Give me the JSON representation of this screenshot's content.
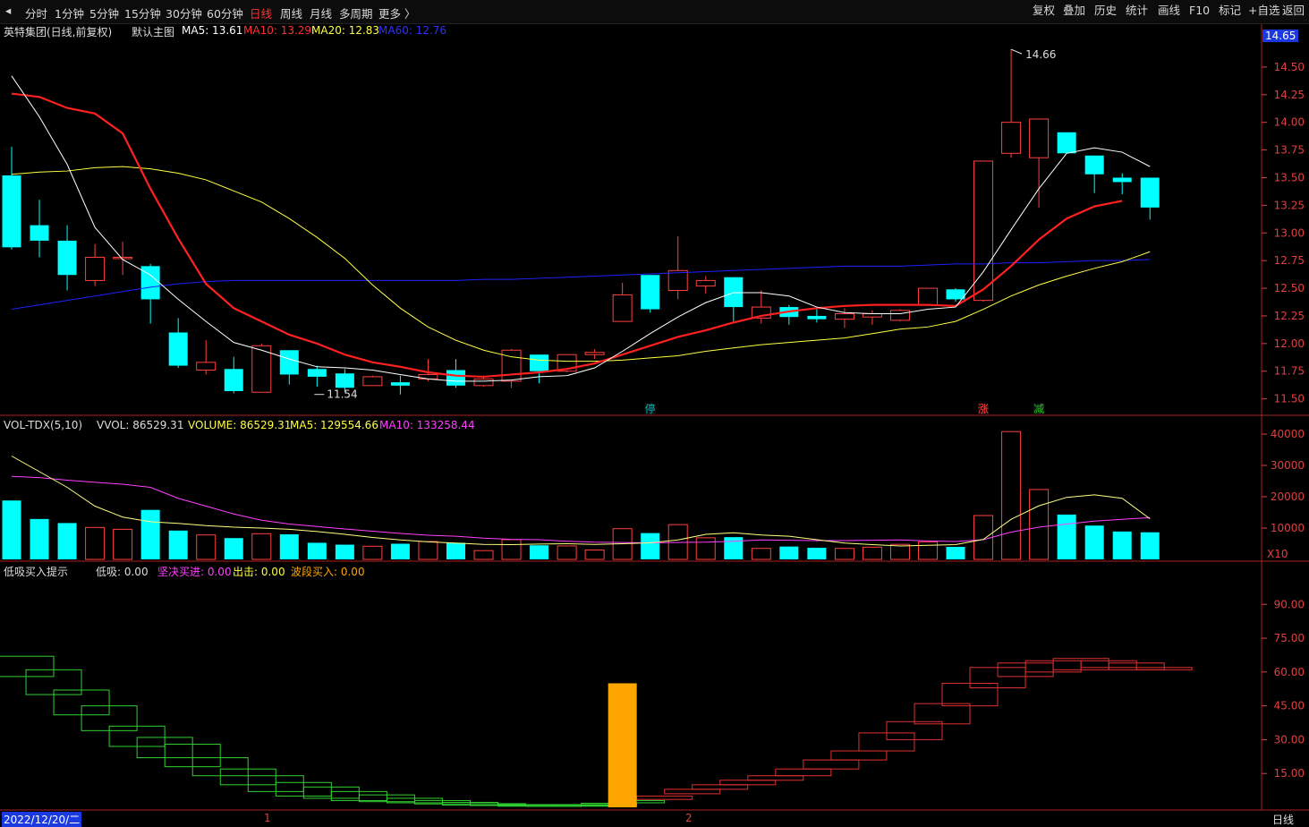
{
  "toolbar": {
    "periods": [
      "分时",
      "1分钟",
      "5分钟",
      "15分钟",
      "30分钟",
      "60分钟",
      "日线",
      "周线",
      "月线",
      "多周期",
      "更多 〉"
    ],
    "active_period": "日线",
    "actions": [
      "复权",
      "叠加",
      "历史",
      "统计",
      "画线",
      "F10",
      "标记",
      "+自选",
      "返回"
    ]
  },
  "main_panel": {
    "title": "英特集团(日线,前复权)",
    "subtitle": "默认主图",
    "ma5": "MA5: 13.61",
    "ma10": "MA10: 13.29",
    "ma20": "MA20: 12.83",
    "ma60": "MA60: 12.76",
    "current_price": "14.65",
    "high_marker": "14.66",
    "low_marker": "11.54",
    "event_markers": [
      "停",
      "涨",
      "减"
    ]
  },
  "vol_panel": {
    "title": "VOL-TDX(5,10)",
    "vvol": "VVOL: 86529.31",
    "volume": "VOLUME: 86529.31",
    "ma5": "MA5: 129554.66",
    "ma10": "MA10: 133258.44",
    "unit": "X10"
  },
  "ind_panel": {
    "title": "低吸买入提示",
    "dixi": "低吸: 0.00",
    "jianjue": "坚决买进: 0.00",
    "chuji": "出击: 0.00",
    "boduan": "波段买入: 0.00"
  },
  "date_bar": {
    "start_date": "2022/12/20/二",
    "month_1": "1",
    "month_2": "2",
    "period_label": "日线"
  },
  "colors": {
    "up": "#ff4040",
    "down": "#00ffff",
    "ma5": "#ffffff",
    "ma10": "#ff2020",
    "ma20": "#ffff40",
    "ma60": "#2020ff",
    "vol_ma10": "#ff40ff",
    "axis": "#e04040",
    "signal": "#ffa500"
  },
  "chart_data": [
    {
      "type": "candlestick",
      "title": "英特集团(日线,前复权)",
      "ylim": [
        11.4,
        14.75
      ],
      "y_ticks": [
        11.5,
        11.75,
        12.0,
        12.25,
        12.5,
        12.75,
        13.0,
        13.25,
        13.5,
        13.75,
        14.0,
        14.25,
        14.5
      ],
      "y_tick_labels": [
        "11.50",
        "11.75",
        "12.00",
        "12.25",
        "12.50",
        "12.75",
        "13.00",
        "13.25",
        "13.50",
        "13.75",
        "14.00",
        "14.25",
        "14.50"
      ],
      "ohlc": [
        [
          13.52,
          13.78,
          12.85,
          12.87
        ],
        [
          13.07,
          13.3,
          12.78,
          12.93
        ],
        [
          12.93,
          13.07,
          12.48,
          12.62
        ],
        [
          12.57,
          12.9,
          12.52,
          12.78
        ],
        [
          12.78,
          12.92,
          12.62,
          12.78
        ],
        [
          12.7,
          12.72,
          12.18,
          12.4
        ],
        [
          12.1,
          12.23,
          11.78,
          11.8
        ],
        [
          11.76,
          12.03,
          11.72,
          11.83
        ],
        [
          11.77,
          11.88,
          11.55,
          11.57
        ],
        [
          11.56,
          12.0,
          11.56,
          11.98
        ],
        [
          11.94,
          11.94,
          11.63,
          11.72
        ],
        [
          11.77,
          11.8,
          11.61,
          11.7
        ],
        [
          11.73,
          11.77,
          11.56,
          11.6
        ],
        [
          11.62,
          11.71,
          11.62,
          11.7
        ],
        [
          11.65,
          11.71,
          11.54,
          11.62
        ],
        [
          11.68,
          11.86,
          11.66,
          11.72
        ],
        [
          11.76,
          11.86,
          11.6,
          11.62
        ],
        [
          11.62,
          11.71,
          11.61,
          11.68
        ],
        [
          11.66,
          11.95,
          11.6,
          11.94
        ],
        [
          11.9,
          11.9,
          11.64,
          11.75
        ],
        [
          11.75,
          11.9,
          11.74,
          11.9
        ],
        [
          11.9,
          11.95,
          11.86,
          11.92
        ],
        [
          12.2,
          12.55,
          12.2,
          12.44
        ],
        [
          12.62,
          12.62,
          12.28,
          12.31
        ],
        [
          12.48,
          12.97,
          12.4,
          12.66
        ],
        [
          12.52,
          12.61,
          12.45,
          12.57
        ],
        [
          12.6,
          12.6,
          12.2,
          12.33
        ],
        [
          12.23,
          12.48,
          12.18,
          12.33
        ],
        [
          12.33,
          12.35,
          12.17,
          12.24
        ],
        [
          12.25,
          12.31,
          12.19,
          12.22
        ],
        [
          12.22,
          12.32,
          12.14,
          12.27
        ],
        [
          12.24,
          12.3,
          12.17,
          12.27
        ],
        [
          12.21,
          12.31,
          12.2,
          12.3
        ],
        [
          12.35,
          12.5,
          12.35,
          12.5
        ],
        [
          12.49,
          12.5,
          12.38,
          12.4
        ],
        [
          12.39,
          13.65,
          12.38,
          13.65
        ],
        [
          13.72,
          14.66,
          13.68,
          14.0
        ],
        [
          13.68,
          14.03,
          13.23,
          14.03
        ],
        [
          13.91,
          13.91,
          13.72,
          13.72
        ],
        [
          13.7,
          13.7,
          13.36,
          13.53
        ],
        [
          13.5,
          13.54,
          13.35,
          13.46
        ],
        [
          13.5,
          13.5,
          13.12,
          13.23
        ]
      ],
      "ma5": [
        14.42,
        14.05,
        13.62,
        13.05,
        12.76,
        12.62,
        12.4,
        12.2,
        12.01,
        11.94,
        11.86,
        11.79,
        11.78,
        11.76,
        11.72,
        11.68,
        11.66,
        11.66,
        11.67,
        11.7,
        11.71,
        11.78,
        11.93,
        12.09,
        12.24,
        12.37,
        12.46,
        12.46,
        12.43,
        12.33,
        12.28,
        12.27,
        12.27,
        12.31,
        12.33,
        12.65,
        13.03,
        13.4,
        13.72,
        13.77,
        13.73,
        13.6
      ],
      "ma10": [
        14.26,
        14.23,
        14.13,
        14.08,
        13.9,
        13.4,
        12.95,
        12.54,
        12.32,
        12.2,
        12.08,
        12.0,
        11.9,
        11.83,
        11.79,
        11.74,
        11.71,
        11.7,
        11.72,
        11.74,
        11.77,
        11.82,
        11.9,
        11.98,
        12.06,
        12.12,
        12.19,
        12.25,
        12.29,
        12.32,
        12.34,
        12.35,
        12.35,
        12.35,
        12.34,
        12.49,
        12.7,
        12.94,
        13.13,
        13.24,
        13.29
      ],
      "ma20": [
        13.53,
        13.55,
        13.56,
        13.59,
        13.6,
        13.58,
        13.54,
        13.48,
        13.38,
        13.28,
        13.13,
        12.96,
        12.77,
        12.53,
        12.32,
        12.15,
        12.03,
        11.94,
        11.88,
        11.85,
        11.84,
        11.84,
        11.85,
        11.87,
        11.89,
        11.93,
        11.96,
        11.99,
        12.01,
        12.03,
        12.05,
        12.09,
        12.13,
        12.15,
        12.2,
        12.31,
        12.43,
        12.53,
        12.61,
        12.68,
        12.74,
        12.83
      ],
      "ma60": [
        12.31,
        12.35,
        12.39,
        12.43,
        12.47,
        12.51,
        12.54,
        12.56,
        12.57,
        12.57,
        12.57,
        12.57,
        12.57,
        12.57,
        12.57,
        12.57,
        12.57,
        12.58,
        12.58,
        12.59,
        12.6,
        12.61,
        12.62,
        12.63,
        12.64,
        12.65,
        12.66,
        12.67,
        12.68,
        12.69,
        12.7,
        12.7,
        12.7,
        12.71,
        12.72,
        12.72,
        12.73,
        12.73,
        12.74,
        12.75,
        12.75,
        12.76
      ]
    },
    {
      "type": "bar",
      "title": "VOL-TDX(5,10)",
      "ylim": [
        0,
        42000
      ],
      "y_ticks": [
        10000,
        20000,
        30000,
        40000
      ],
      "y_tick_labels": [
        "10000",
        "20000",
        "30000",
        "40000"
      ],
      "volume": [
        18800,
        12900,
        11600,
        10200,
        9600,
        15800,
        9200,
        7800,
        6800,
        8200,
        8000,
        5300,
        4700,
        4200,
        5000,
        5700,
        5300,
        2800,
        6300,
        4500,
        4300,
        3000,
        9800,
        8400,
        11100,
        6900,
        7100,
        3500,
        4100,
        3700,
        3500,
        3900,
        4800,
        5600,
        4000,
        14000,
        40800,
        22300,
        14300,
        10800,
        8900,
        8650
      ],
      "vol_ma5": [
        33000,
        28000,
        23000,
        17000,
        13500,
        12000,
        11500,
        10800,
        10300,
        10000,
        9600,
        8900,
        8000,
        7000,
        6200,
        5600,
        5200,
        4800,
        4700,
        4900,
        5000,
        4800,
        5000,
        5300,
        6200,
        8000,
        8500,
        7800,
        7400,
        6300,
        5200,
        4700,
        4300,
        4500,
        4700,
        6400,
        12800,
        17100,
        19800,
        20600,
        19500,
        12960
      ],
      "vol_ma10": [
        26500,
        26100,
        25300,
        24600,
        24000,
        23000,
        19500,
        17000,
        14500,
        12500,
        11300,
        10500,
        9700,
        9000,
        8300,
        7700,
        7400,
        6800,
        6400,
        6300,
        5800,
        5500,
        5400,
        5300,
        5400,
        5500,
        5800,
        6200,
        6100,
        6000,
        6000,
        6100,
        6200,
        5900,
        5700,
        6300,
        8700,
        10300,
        11300,
        12200,
        12800,
        13330
      ]
    },
    {
      "type": "custom-indicator",
      "title": "低吸买入提示",
      "ylim": [
        0,
        104
      ],
      "y_ticks": [
        15,
        30,
        45,
        60,
        75,
        90
      ],
      "y_tick_labels": [
        "15.00",
        "30.00",
        "45.00",
        "60.00",
        "75.00",
        "90.00"
      ],
      "boxes": [
        [
          58,
          67
        ],
        [
          50,
          61
        ],
        [
          41,
          52
        ],
        [
          34,
          45
        ],
        [
          27,
          36
        ],
        [
          22,
          31
        ],
        [
          18,
          28
        ],
        [
          14,
          22
        ],
        [
          10,
          17
        ],
        [
          7,
          14
        ],
        [
          5,
          11
        ],
        [
          4,
          9
        ],
        [
          3,
          7
        ],
        [
          2.5,
          5.5
        ],
        [
          2,
          4
        ],
        [
          1.5,
          3
        ],
        [
          1,
          2.2
        ],
        [
          0.8,
          1.6
        ],
        [
          0.5,
          1.2
        ],
        [
          0.4,
          0.9
        ],
        [
          0.5,
          1.2
        ],
        [
          0.8,
          1.8
        ],
        [
          2,
          3
        ],
        [
          3.5,
          5
        ],
        [
          6,
          8
        ],
        [
          8,
          10
        ],
        [
          10,
          12
        ],
        [
          12,
          14
        ],
        [
          14,
          17
        ],
        [
          17,
          21
        ],
        [
          21,
          25
        ],
        [
          25,
          33
        ],
        [
          30,
          38
        ],
        [
          37,
          46
        ],
        [
          45,
          55
        ],
        [
          53,
          62
        ],
        [
          58,
          64
        ],
        [
          60,
          65
        ],
        [
          61,
          66
        ],
        [
          62,
          65
        ],
        [
          61,
          64
        ],
        [
          61,
          62
        ]
      ],
      "signal_index": 22,
      "signal_value": 55
    }
  ]
}
